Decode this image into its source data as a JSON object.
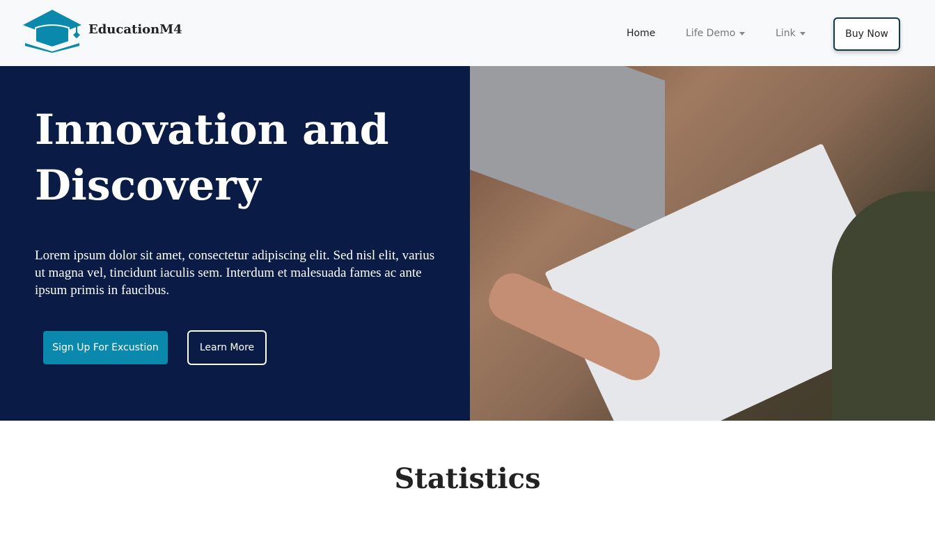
{
  "nav": {
    "brand": "EducationM4",
    "items": [
      {
        "label": "Home"
      },
      {
        "label": "Life Demo"
      },
      {
        "label": "Link"
      }
    ],
    "buy": "Buy Now"
  },
  "hero": {
    "title": "Innovation and Discovery",
    "lead": "Lorem ipsum dolor sit amet, consectetur adipiscing elit. Sed nisl elit, varius ut magna vel, tincidunt iaculis sem. Interdum et malesuada fames ac ante ipsum primis in faucibus.",
    "primary": "Sign Up For Excustion",
    "secondary": "Learn More"
  },
  "stats": {
    "title": "Statistics"
  },
  "colors": {
    "navy": "#0a1c46",
    "accent": "#0a89ad"
  }
}
